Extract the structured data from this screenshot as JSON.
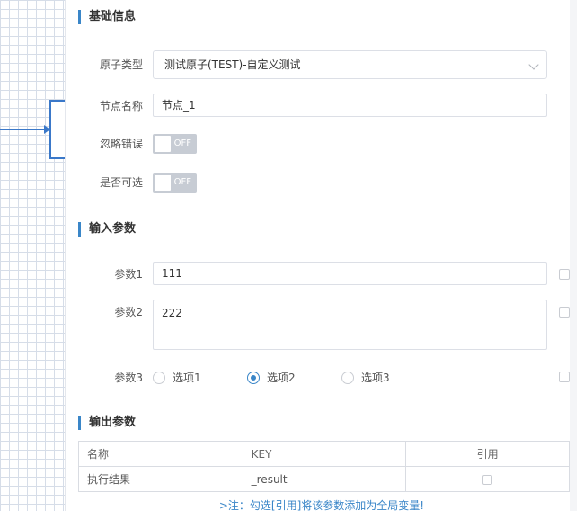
{
  "basic": {
    "title": "基础信息",
    "atom_type_label": "原子类型",
    "atom_type_value": "测试原子(TEST)-自定义测试",
    "node_name_label": "节点名称",
    "node_name_value": "节点_1",
    "ignore_error_label": "忽略错误",
    "ignore_error_state": "OFF",
    "optional_label": "是否可选",
    "optional_state": "OFF"
  },
  "inputs": {
    "title": "输入参数",
    "param1_label": "参数1",
    "param1_value": "111",
    "param2_label": "参数2",
    "param2_value": "222",
    "param3_label": "参数3",
    "param3_options": [
      "选项1",
      "选项2",
      "选项3"
    ],
    "param3_selected": "选项2"
  },
  "outputs": {
    "title": "输出参数",
    "columns": [
      "名称",
      "KEY",
      "引用"
    ],
    "rows": [
      {
        "name": "执行结果",
        "key": "_result"
      }
    ],
    "note": ">注：勾选[引用]将该参数添加为全局变量!"
  },
  "colors": {
    "accent": "#3a86c8",
    "toggle_off": "#c7ccd4",
    "connector": "#3a78c9"
  }
}
